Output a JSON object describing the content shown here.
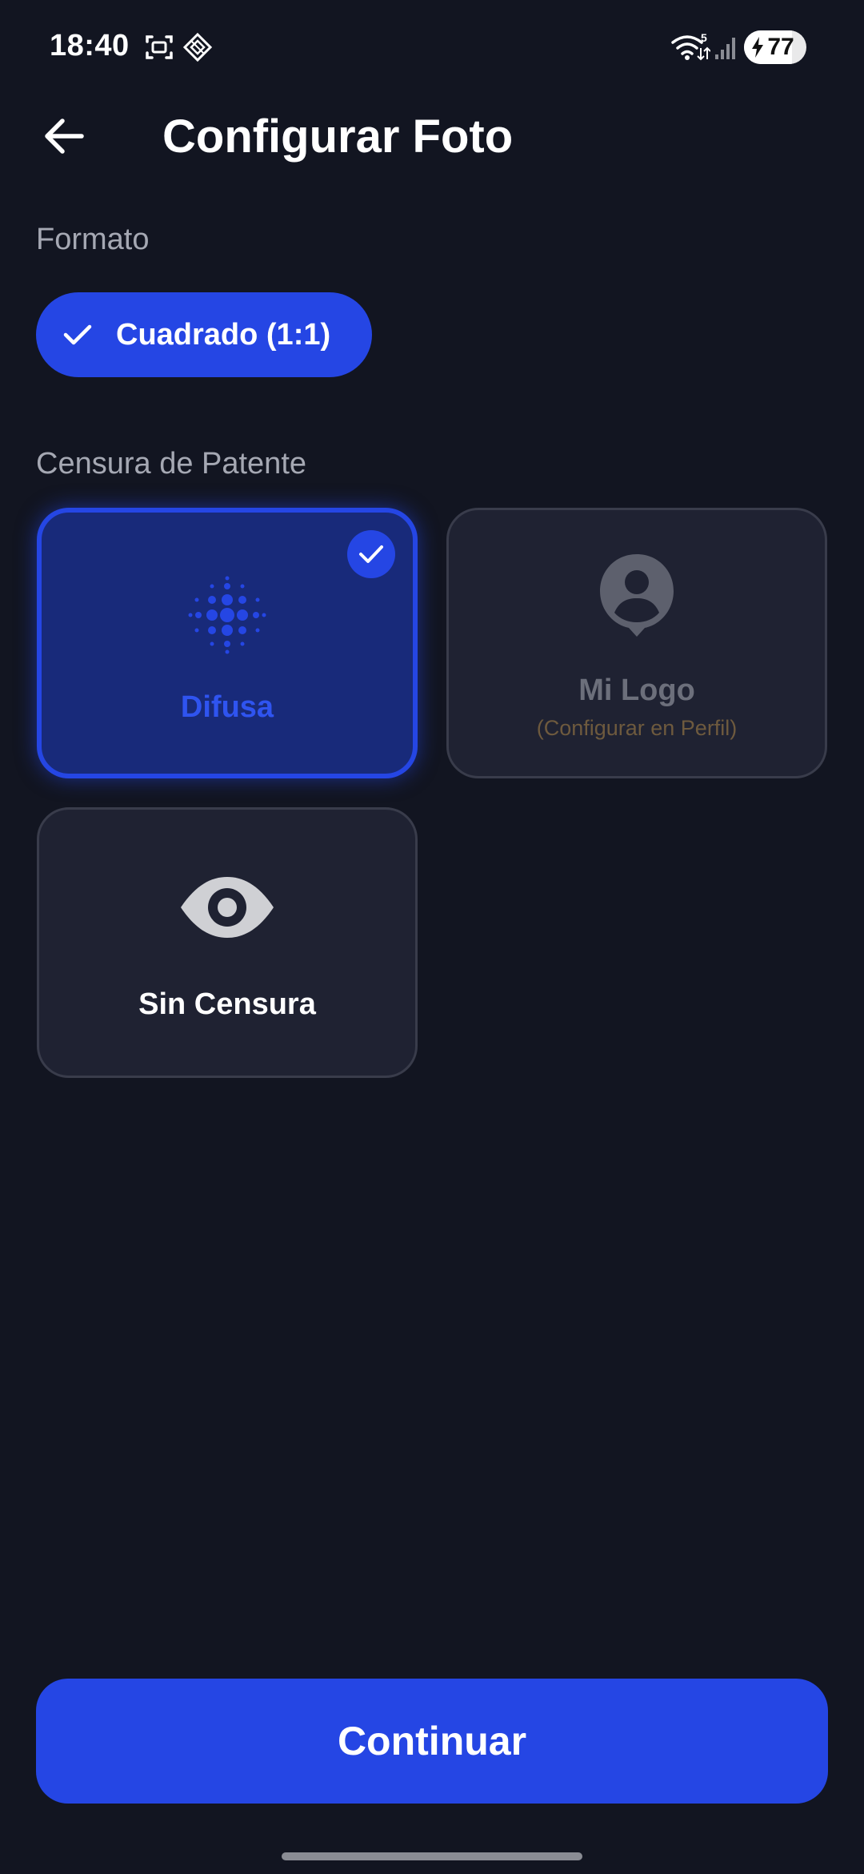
{
  "status_bar": {
    "time": "18:40",
    "battery_level": "77",
    "battery_fraction": 0.77,
    "icons": [
      "screenshot-icon",
      "app-icon",
      "wifi-icon",
      "signal-icon",
      "battery-icon"
    ]
  },
  "app_bar": {
    "title": "Configurar Foto",
    "back_icon": "arrow-left-icon"
  },
  "format": {
    "section_label": "Formato",
    "selected_option": "Cuadrado (1:1)",
    "option_icon": "check-icon"
  },
  "censorship": {
    "section_label": "Censura de Patente",
    "options": [
      {
        "label": "Difusa",
        "sublabel": "",
        "icon": "blur-icon",
        "selected": true
      },
      {
        "label": "Mi Logo",
        "sublabel": "(Configurar en Perfil)",
        "icon": "account-pin-icon",
        "selected": false
      },
      {
        "label": "Sin Censura",
        "sublabel": "",
        "icon": "eye-icon",
        "selected": false
      }
    ]
  },
  "actions": {
    "continue_label": "Continuar"
  },
  "colors": {
    "background": "#121521",
    "accent": "#2546e4",
    "card": "#1f2232",
    "card_selected": "#182a7a",
    "muted_text": "#a5a8b3",
    "sublabel_text": "#6e5a3e"
  }
}
